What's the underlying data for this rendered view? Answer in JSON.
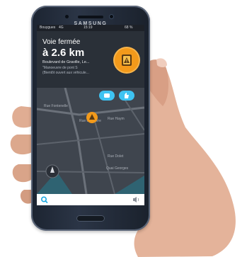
{
  "device": {
    "brand": "SAMSUNG"
  },
  "status_bar": {
    "carrier": "Bouygues",
    "network": "4G",
    "time": "15:19",
    "battery": "68 %"
  },
  "alert": {
    "title": "Voie fermée",
    "distance": "à 2.6 km",
    "street": "Boulevard de Graville, Le...",
    "note_line1": "\"Manoeuvre de pont S",
    "note_line2": "(Bientôt ouvert aux véhicule...",
    "icon": "road-closed-warning-icon",
    "badge_color": "#f39a1b"
  },
  "map": {
    "street_labels": [
      "Rue Fontenelle",
      "Rue du Havre",
      "Rue Haym",
      "Rue Dolet",
      "Quai Georges"
    ],
    "accent_color": "#3ec3f2",
    "buttons": [
      {
        "icon": "chat-icon"
      },
      {
        "icon": "thumbs-up-icon"
      }
    ],
    "compass_icon": "compass-icon",
    "marker_icon": "warning-marker-icon"
  },
  "search": {
    "search_icon": "search-icon",
    "speaker_icon": "speaker-icon",
    "accent_color": "#1aa7e0"
  }
}
